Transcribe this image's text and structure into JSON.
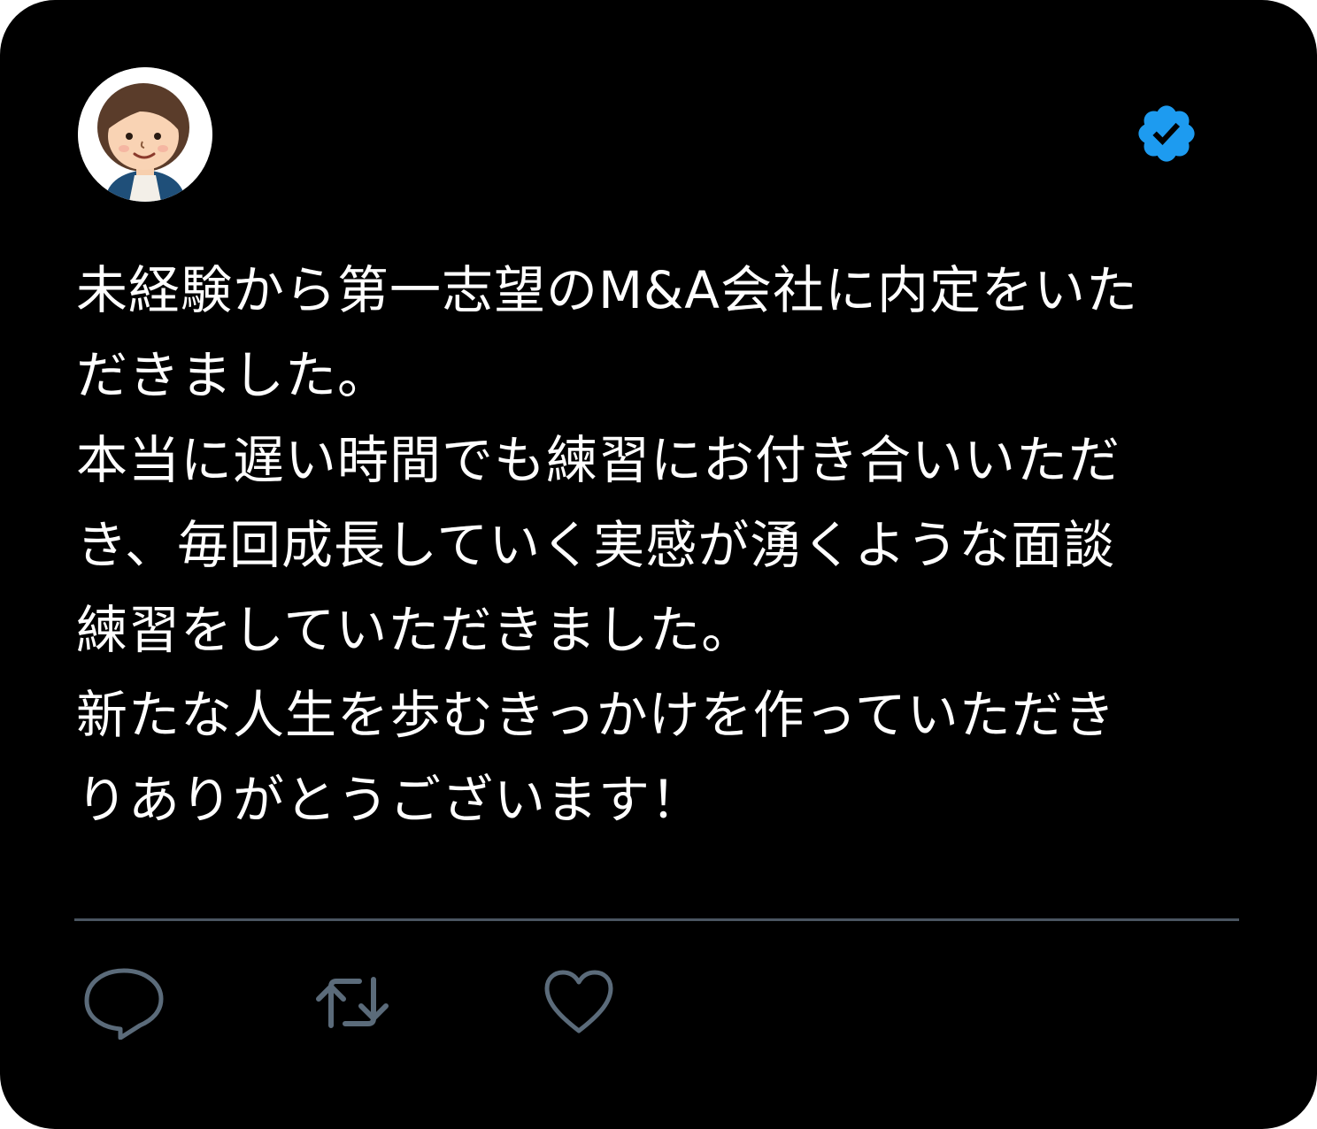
{
  "tweet": {
    "author": {
      "avatar_icon": "woman-avatar-icon",
      "verified_icon": "verified-badge-icon",
      "verified_color": "#1d9bf0"
    },
    "text_lines": [
      "未経験から第一志望のM&A会社に内定をいた",
      "だきました。",
      "本当に遅い時間でも練習にお付き合いいただ",
      "き、毎回成長していく実感が湧くような面談",
      "練習をしていただきました。",
      "新たな人生を歩むきっかけを作っていただき",
      "りありがとうございます！"
    ],
    "actions": {
      "reply_icon": "reply-bubble-icon",
      "retweet_icon": "retweet-icon",
      "like_icon": "heart-icon",
      "icon_color": "#5b6b7a"
    }
  }
}
